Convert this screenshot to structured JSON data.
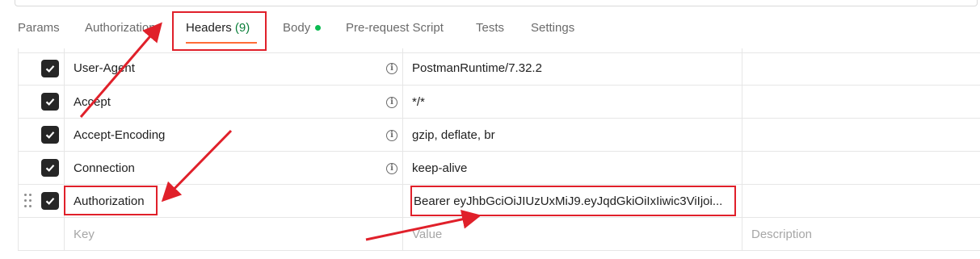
{
  "tabs": [
    {
      "label": "Params"
    },
    {
      "label": "Authorization"
    },
    {
      "label": "Headers",
      "count": "(9)"
    },
    {
      "label": "Body"
    },
    {
      "label": "Pre-request Script"
    },
    {
      "label": "Tests"
    },
    {
      "label": "Settings"
    }
  ],
  "active_tab": "Headers",
  "headers": [
    {
      "key": "User-Agent",
      "value": "PostmanRuntime/7.32.2",
      "checked": true
    },
    {
      "key": "Accept",
      "value": "*/*",
      "checked": true
    },
    {
      "key": "Accept-Encoding",
      "value": "gzip, deflate, br",
      "checked": true
    },
    {
      "key": "Connection",
      "value": "keep-alive",
      "checked": true
    },
    {
      "key": "Authorization",
      "value": "Bearer eyJhbGciOiJIUzUxMiJ9.eyJqdGkiOiIxIiwic3ViIjoi...",
      "checked": true
    }
  ],
  "placeholders": {
    "key": "Key",
    "value": "Value",
    "description": "Description"
  },
  "colors": {
    "active_underline": "#ff6c37",
    "body_dot": "#0cbb52",
    "count": "#0b7f3a",
    "annotation": "#e0202a"
  },
  "icons": {
    "info": "info-circle-icon",
    "check": "checkmark-icon",
    "drag": "drag-handle-icon"
  }
}
